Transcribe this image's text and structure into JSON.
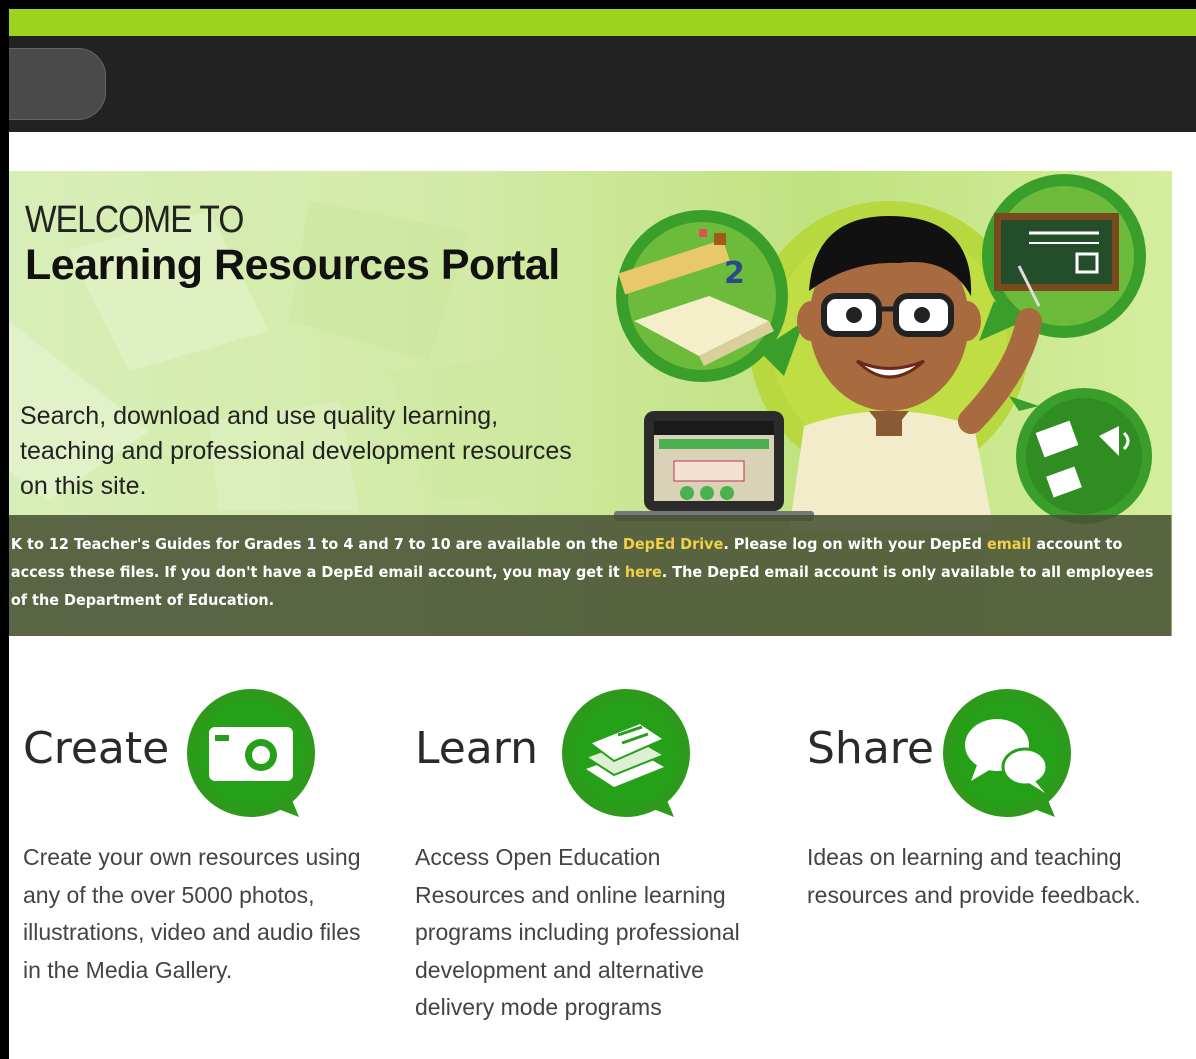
{
  "banner": {
    "welcome": "WELCOME TO",
    "title": "Learning Resources Portal",
    "tagline": "Search, download and use quality learning, teaching and professional development resources on this site."
  },
  "notice": {
    "part1": "K to 12 Teacher's Guides for Grades 1 to 4 and 7 to 10 are available on the ",
    "link_drive": "DepEd Drive",
    "part2": ". Please log on with your DepEd ",
    "link_email": "email",
    "part3": " account to access these files. If you don't have a DepEd email account, you may get it ",
    "link_here": "here",
    "part4": ". The DepEd email account is only available to all employees of the Department of Education."
  },
  "features": [
    {
      "title": "Create",
      "icon": "camera-icon",
      "description": "Create your own resources using any of the over 5000 photos, illustrations, video and audio files in the Media Gallery."
    },
    {
      "title": "Learn",
      "icon": "books-icon",
      "description": "Access Open Education Resources and online learning programs including professional development and alternative delivery mode programs"
    },
    {
      "title": "Share",
      "icon": "chat-bubbles-icon",
      "description": "Ideas on learning and teaching resources and provide feedback."
    }
  ],
  "colors": {
    "top_bar": "#9bd31e",
    "nav_bar": "#222222",
    "icon_green": "#2e9a1c",
    "link_yellow": "#f1d048"
  }
}
